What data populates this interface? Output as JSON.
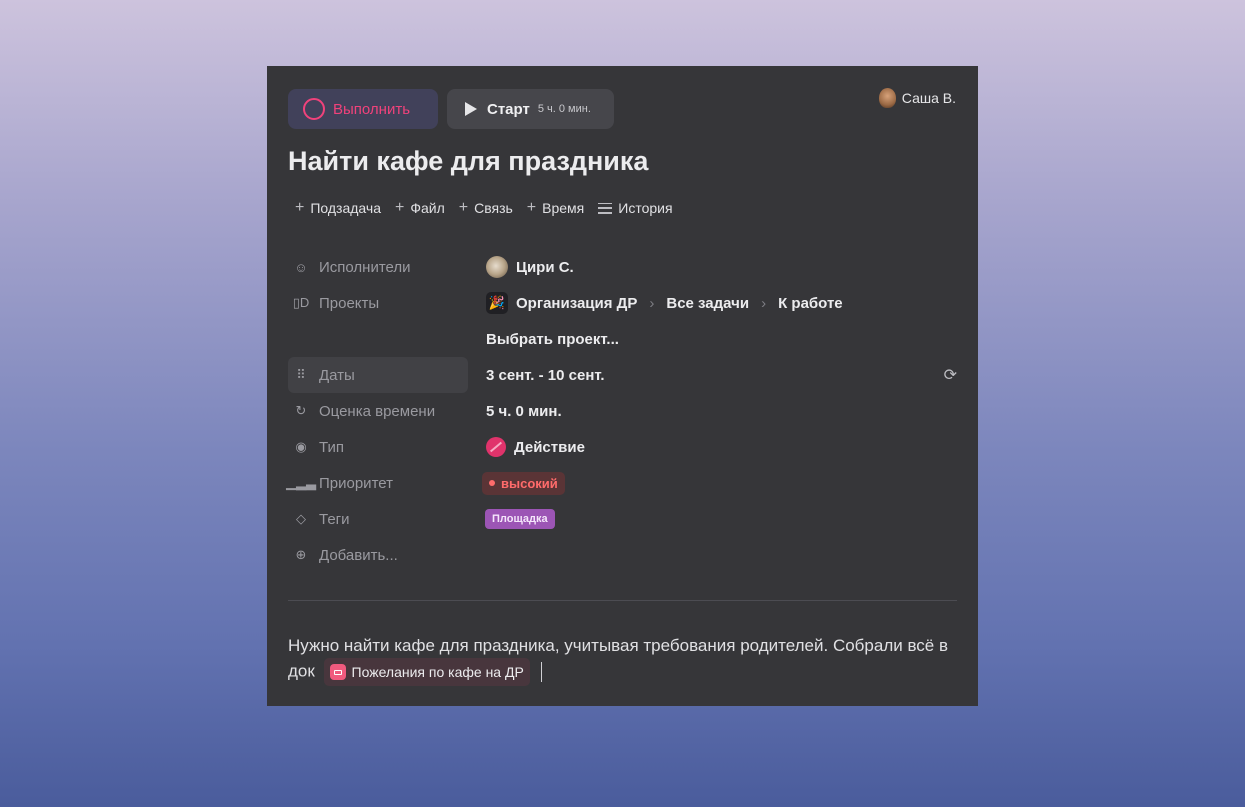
{
  "header": {
    "complete_label": "Выполнить",
    "start_label": "Старт",
    "start_duration": "5 ч. 0 мин.",
    "user_name": "Саша В."
  },
  "task": {
    "title": "Найти кафе для праздника"
  },
  "actions": [
    {
      "label": "Подзадача",
      "icon": "plus-icon"
    },
    {
      "label": "Файл",
      "icon": "plus-icon"
    },
    {
      "label": "Связь",
      "icon": "plus-icon"
    },
    {
      "label": "Время",
      "icon": "plus-icon"
    },
    {
      "label": "История",
      "icon": "list-icon"
    }
  ],
  "fields": {
    "assignees": {
      "label": "Исполнители",
      "value": "Цири С."
    },
    "projects": {
      "label": "Проекты",
      "path": [
        "Организация ДР",
        "Все задачи",
        "К работе"
      ],
      "choose": "Выбрать проект..."
    },
    "dates": {
      "label": "Даты",
      "value": "3 сент. - 10 сент."
    },
    "estimate": {
      "label": "Оценка времени",
      "value": "5 ч. 0 мин."
    },
    "type": {
      "label": "Тип",
      "value": "Действие"
    },
    "priority": {
      "label": "Приоритет",
      "value": "высокий"
    },
    "tags": {
      "label": "Теги",
      "value": "Площадка"
    },
    "add": {
      "label": "Добавить..."
    }
  },
  "description": {
    "text": "Нужно найти кафе для праздника, учитывая требования родителей. Собрали всё в док",
    "doc_link": "Пожелания по кафе на ДР"
  },
  "colors": {
    "accent": "#f0427b",
    "priority_high": "#ff6b6b",
    "tag": "#9c55b5"
  }
}
